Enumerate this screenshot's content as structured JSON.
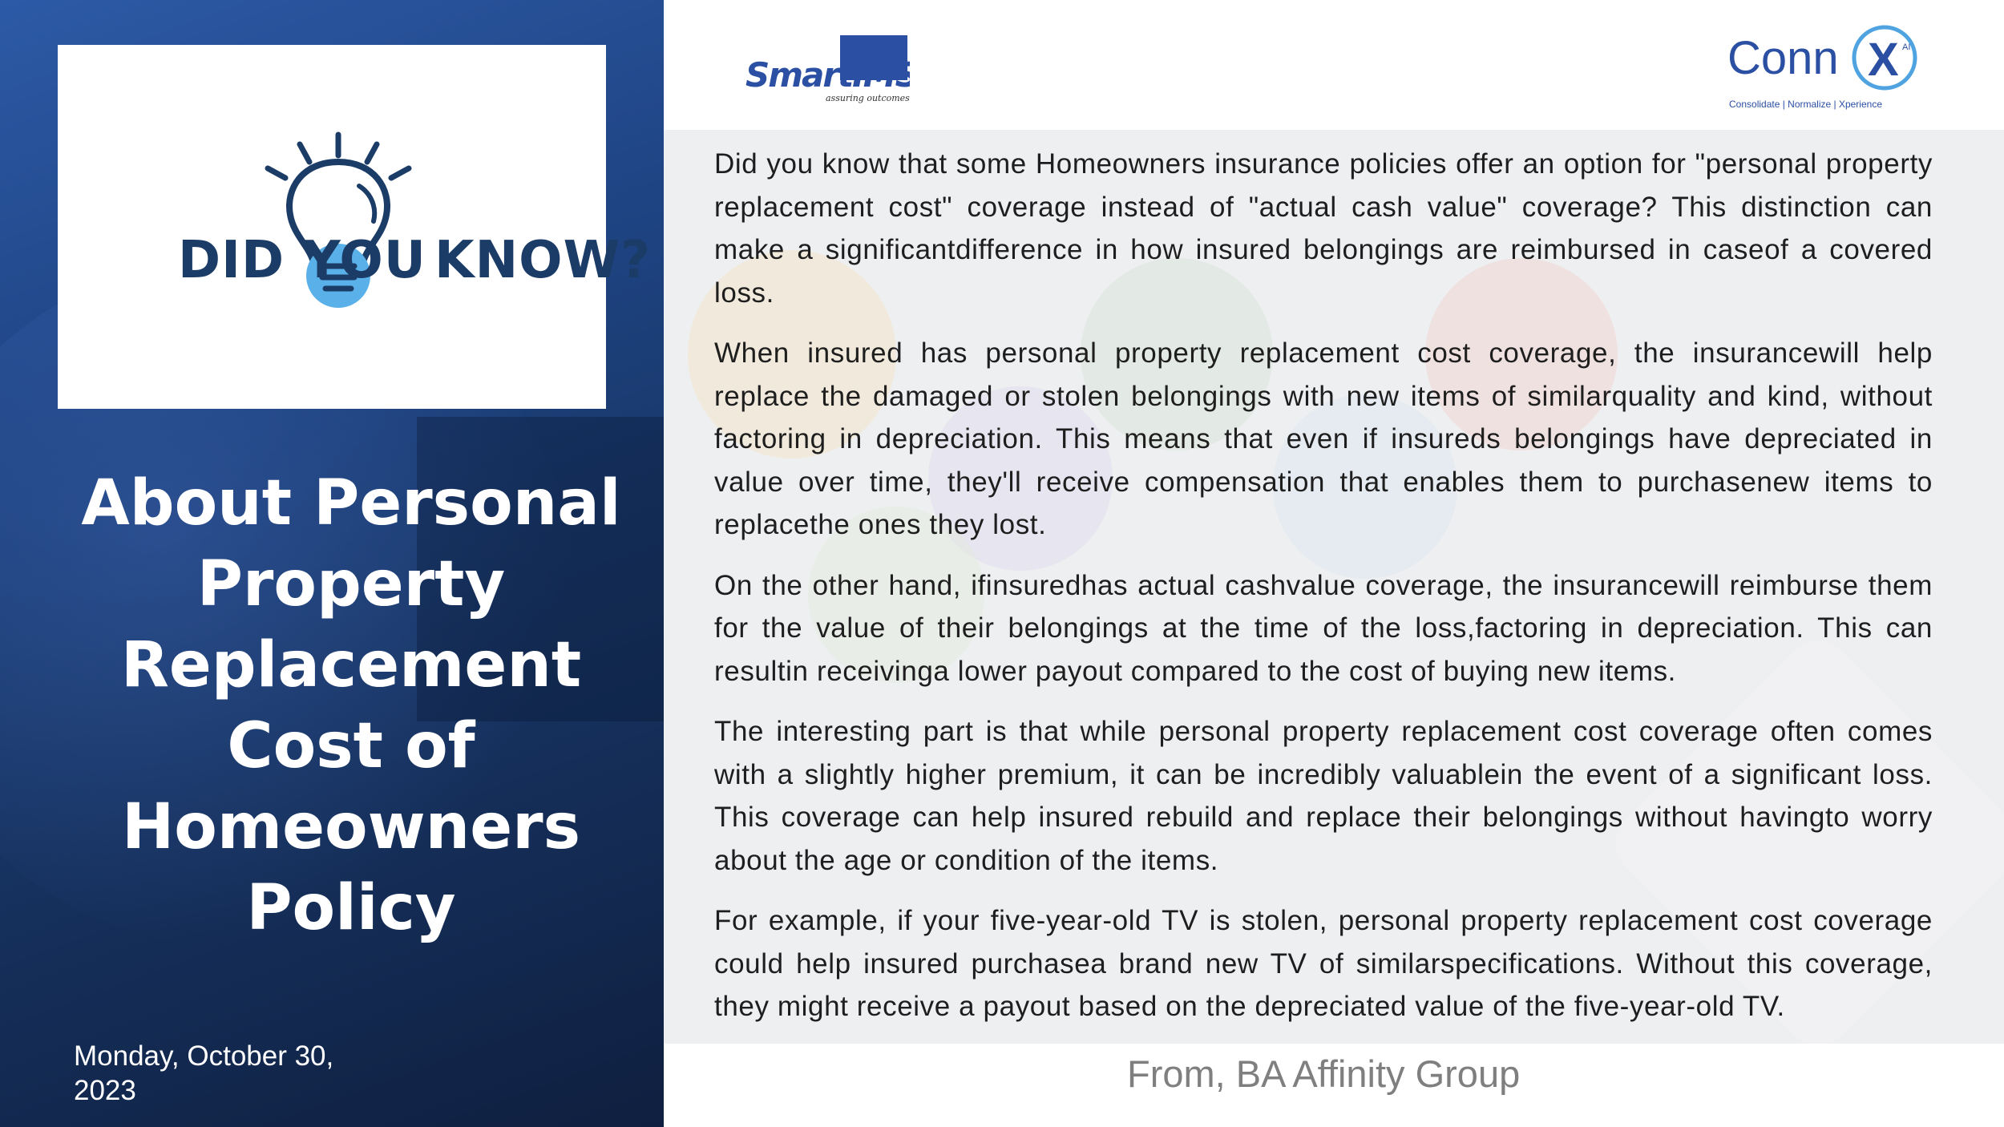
{
  "left": {
    "dyk_words": [
      "DID YOU",
      "KNOW?"
    ],
    "title_lines": [
      "About Personal",
      "Property",
      "Replacement",
      "Cost of",
      "Homeowners",
      "Policy"
    ],
    "date_lines": [
      "Monday, October 30,",
      "2023"
    ]
  },
  "logos": {
    "smartims": {
      "brand": "SmartIMS",
      "tagline": "assuring outcomes"
    },
    "connx": {
      "brand": "Conn",
      "mark": "X",
      "superscript": "AI",
      "tagline": "Consolidate | Normalize | Xperience"
    }
  },
  "body": {
    "paragraphs": [
      "Did you know that some Homeowners insurance policies offer an option for \"personal property replacement cost\" coverage instead of \"actual cash value\" coverage? This distinction can make a significantdifference in how insured belongings are reimbursed in caseof a covered loss.",
      "When insured has personal property replacement cost coverage, the insurancewill help replace the damaged or stolen belongings with new items of similarquality and kind, without factoring in depreciation. This means that even if insureds belongings have depreciated in value over time, they'll receive compensation that enables them to purchasenew items to replacethe ones they lost.",
      "On the other hand, ifinsuredhas actual cashvalue coverage, the insurancewill reimburse them for the value of their belongings at the time of the loss,factoring in depreciation. This can resultin receivinga lower payout compared to the cost of buying new items.",
      "The interesting part is that while personal property replacement cost coverage often comes with a slightly higher premium, it can be incredibly valuablein the event of a significant loss. This coverage can help insured rebuild and replace their belongings without havingto worry about the age or condition of the items.",
      "For example, if your five-year-old TV is stolen, personal property replacement cost coverage could help insured purchasea brand new TV of similarspecifications. Without this coverage, they might receive a payout based on the depreciated value of the five-year-old TV."
    ]
  },
  "footer": {
    "from": "From, BA Affinity Group"
  },
  "colors": {
    "navy": "#173463",
    "title_white": "#ffffff",
    "dyk_blue": "#1c3c68",
    "bulb_fill": "#5ab0e8",
    "connx_blue": "#2b4fa3"
  }
}
